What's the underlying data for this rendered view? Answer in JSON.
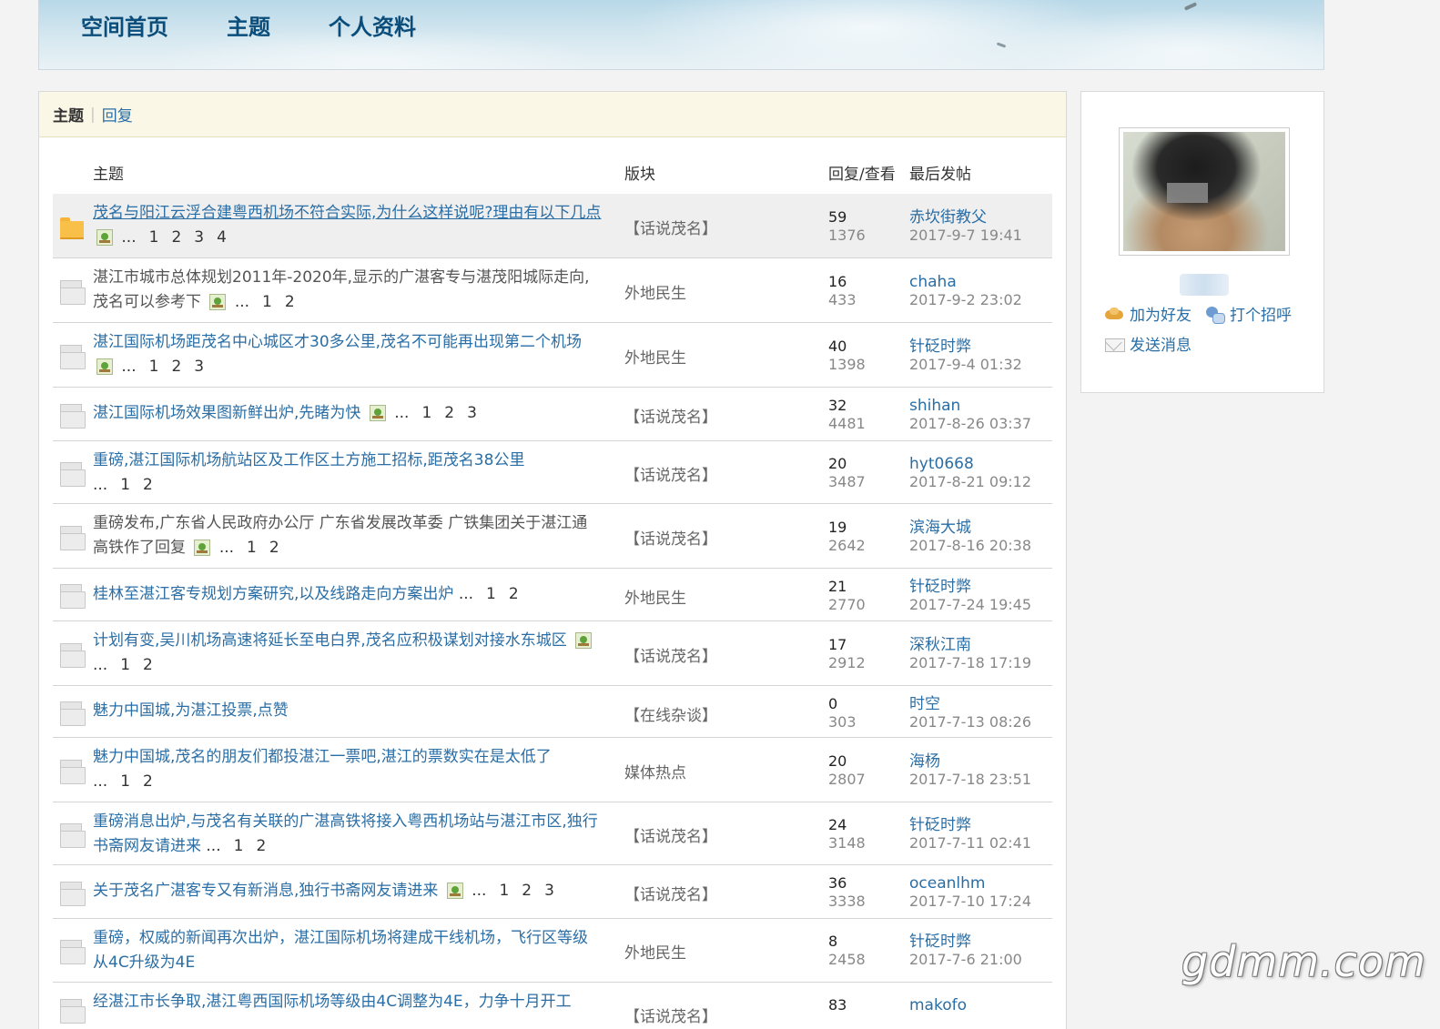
{
  "nav": {
    "home": "空间首页",
    "topics": "主题",
    "profile": "个人资料"
  },
  "tabs": {
    "active": "主题",
    "separator": "|",
    "replies": "回复"
  },
  "columns": {
    "topic": "主题",
    "forum": "版块",
    "reply_view": "回复/查看",
    "last_post": "最后发帖"
  },
  "ellipsis": "...",
  "rows": [
    {
      "title": "茂名与阳江云浮合建粤西机场不符合实际,为什么这样说呢?理由有以下几点",
      "pages": [
        "1",
        "2",
        "3",
        "4"
      ],
      "forum": "【话说茂名】",
      "replies": "59",
      "views": "1376",
      "last_user": "赤坎街教父",
      "last_time": "2017-9-7 19:41"
    },
    {
      "title": "湛江市城市总体规划2011年-2020年,显示的广湛客专与湛茂阳城际走向,茂名可以参考下",
      "pages": [
        "1",
        "2"
      ],
      "forum": "外地民生",
      "replies": "16",
      "views": "433",
      "last_user": "chaha",
      "last_time": "2017-9-2 23:02"
    },
    {
      "title": "湛江国际机场距茂名中心城区才30多公里,茂名不可能再出现第二个机场",
      "pages": [
        "1",
        "2",
        "3"
      ],
      "forum": "外地民生",
      "replies": "40",
      "views": "1398",
      "last_user": "针砭时弊",
      "last_time": "2017-9-4 01:32"
    },
    {
      "title": "湛江国际机场效果图新鲜出炉,先睹为快",
      "pages": [
        "1",
        "2",
        "3"
      ],
      "forum": "【话说茂名】",
      "replies": "32",
      "views": "4481",
      "last_user": "shihan",
      "last_time": "2017-8-26 03:37"
    },
    {
      "title": "重磅,湛江国际机场航站区及工作区土方施工招标,距茂名38公里",
      "pages": [
        "1",
        "2"
      ],
      "forum": "【话说茂名】",
      "replies": "20",
      "views": "3487",
      "last_user": "hyt0668",
      "last_time": "2017-8-21 09:12"
    },
    {
      "title": "重磅发布,广东省人民政府办公厅 广东省发展改革委 广铁集团关于湛江通高铁作了回复",
      "pages": [
        "1",
        "2"
      ],
      "forum": "【话说茂名】",
      "replies": "19",
      "views": "2642",
      "last_user": "滨海大城",
      "last_time": "2017-8-16 20:38"
    },
    {
      "title": "桂林至湛江客专规划方案研究,以及线路走向方案出炉",
      "pages": [
        "1",
        "2"
      ],
      "forum": "外地民生",
      "replies": "21",
      "views": "2770",
      "last_user": "针砭时弊",
      "last_time": "2017-7-24 19:45"
    },
    {
      "title": "计划有变,吴川机场高速将延长至电白界,茂名应积极谋划对接水东城区",
      "pages": [
        "1",
        "2"
      ],
      "forum": "【话说茂名】",
      "replies": "17",
      "views": "2912",
      "last_user": "深秋江南",
      "last_time": "2017-7-18 17:19"
    },
    {
      "title": "魅力中国城,为湛江投票,点赞",
      "pages": [],
      "forum": "【在线杂谈】",
      "replies": "0",
      "views": "303",
      "last_user": "时空",
      "last_time": "2017-7-13 08:26"
    },
    {
      "title": "魅力中国城,茂名的朋友们都投湛江一票吧,湛江的票数实在是太低了",
      "pages": [
        "1",
        "2"
      ],
      "forum": "媒体热点",
      "replies": "20",
      "views": "2807",
      "last_user": "海杨",
      "last_time": "2017-7-18 23:51"
    },
    {
      "title": "重磅消息出炉,与茂名有关联的广湛高铁将接入粤西机场站与湛江市区,独行书斋网友请进来",
      "pages": [
        "1",
        "2"
      ],
      "forum": "【话说茂名】",
      "replies": "24",
      "views": "3148",
      "last_user": "针砭时弊",
      "last_time": "2017-7-11 02:41"
    },
    {
      "title": "关于茂名广湛客专又有新消息,独行书斋网友请进来",
      "pages": [
        "1",
        "2",
        "3"
      ],
      "forum": "【话说茂名】",
      "replies": "36",
      "views": "3338",
      "last_user": "oceanlhm",
      "last_time": "2017-7-10 17:24"
    },
    {
      "title": "重磅，权威的新闻再次出炉，湛江国际机场将建成干线机场，飞行区等级从4C升级为4E",
      "pages": [],
      "forum": "外地民生",
      "replies": "8",
      "views": "2458",
      "last_user": "针砭时弊",
      "last_time": "2017-7-6 21:00"
    },
    {
      "title": "经湛江市长争取,湛江粤西国际机场等级由4C调整为4E，力争十月开工",
      "pages": [],
      "forum": "【话说茂名】",
      "replies": "83",
      "views": "",
      "last_user": "makofo",
      "last_time": ""
    }
  ],
  "profile": {
    "add_friend": "加为好友",
    "greet": "打个招呼",
    "send_message": "发送消息"
  },
  "watermark": "gdmm.com"
}
